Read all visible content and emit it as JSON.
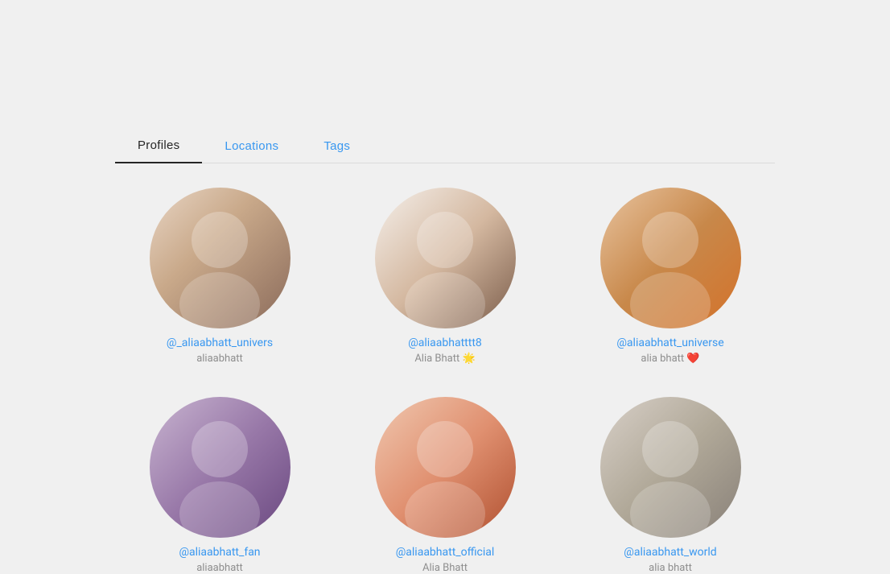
{
  "tabs": [
    {
      "id": "profiles",
      "label": "Profiles",
      "active": true
    },
    {
      "id": "locations",
      "label": "Locations",
      "active": false
    },
    {
      "id": "tags",
      "label": "Tags",
      "active": false
    }
  ],
  "profiles": [
    {
      "id": 1,
      "username": "@_aliaabhatt_univers",
      "fullname": "aliaabhatt",
      "avatar_class": "av1"
    },
    {
      "id": 2,
      "username": "@aliaabhatttt8",
      "fullname": "Alia Bhatt 🌟",
      "avatar_class": "av2"
    },
    {
      "id": 3,
      "username": "@aliaabhatt_universe",
      "fullname": "alia bhatt ❤️",
      "avatar_class": "av3"
    },
    {
      "id": 4,
      "username": "@aliaabhatt_fan",
      "fullname": "aliaabhatt",
      "avatar_class": "av4"
    },
    {
      "id": 5,
      "username": "@aliaabhatt_official",
      "fullname": "Alia Bhatt",
      "avatar_class": "av5"
    },
    {
      "id": 6,
      "username": "@aliaabhatt_world",
      "fullname": "alia bhatt",
      "avatar_class": "av6"
    }
  ]
}
